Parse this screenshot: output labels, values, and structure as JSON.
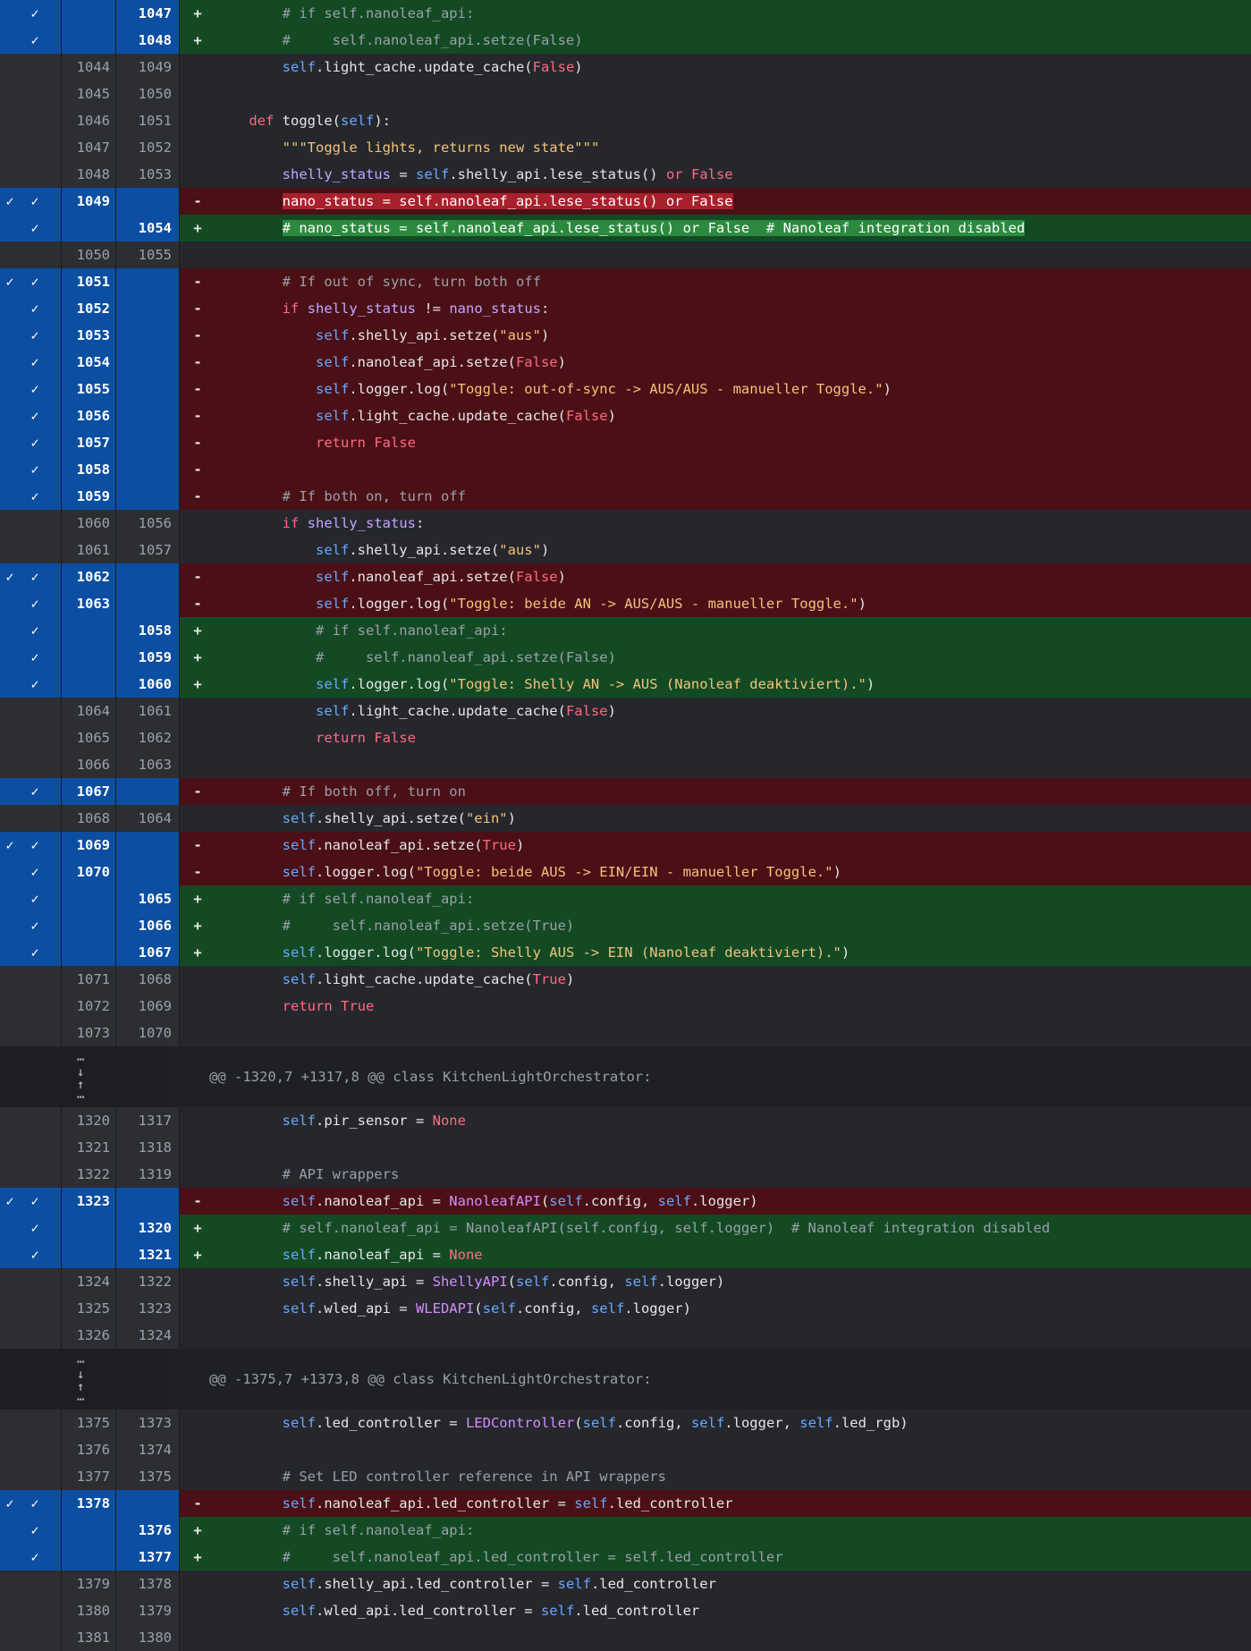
{
  "diff": {
    "rows": [
      {
        "type": "hunk_tail_add",
        "old": "",
        "new": "1047",
        "mark": "+",
        "code": "        # if self.nanoleaf_api:",
        "style": "add",
        "sel": true,
        "checks": 1
      },
      {
        "type": "add",
        "old": "",
        "new": "1048",
        "mark": "+",
        "code": "        #     self.nanoleaf_api.setze(False)",
        "style": "add",
        "sel": true,
        "checks": 1
      },
      {
        "type": "ctx",
        "old": "1044",
        "new": "1049",
        "mark": "",
        "code": "        self.light_cache.update_cache(False)",
        "style": "ctx",
        "sel": false
      },
      {
        "type": "ctx",
        "old": "1045",
        "new": "1050",
        "mark": "",
        "code": "",
        "style": "ctx",
        "sel": false
      },
      {
        "type": "ctx",
        "old": "1046",
        "new": "1051",
        "mark": "",
        "code": "    def toggle(self):",
        "style": "ctx",
        "sel": false
      },
      {
        "type": "ctx",
        "old": "1047",
        "new": "1052",
        "mark": "",
        "code": "        \"\"\"Toggle lights, returns new state\"\"\"",
        "style": "ctx",
        "sel": false
      },
      {
        "type": "ctx",
        "old": "1048",
        "new": "1053",
        "mark": "",
        "code": "        shelly_status = self.shelly_api.lese_status() or False",
        "style": "ctx",
        "sel": false
      },
      {
        "type": "del",
        "old": "1049",
        "new": "",
        "mark": "-",
        "code": "        nano_status = self.nanoleaf_api.lese_status() or False",
        "style": "del",
        "sel": true,
        "checks": 2,
        "hl": true
      },
      {
        "type": "add",
        "old": "",
        "new": "1054",
        "mark": "+",
        "code": "        # nano_status = self.nanoleaf_api.lese_status() or False  # Nanoleaf integration disabled",
        "style": "add",
        "sel": true,
        "checks": 1,
        "hl": true
      },
      {
        "type": "ctx",
        "old": "1050",
        "new": "1055",
        "mark": "",
        "code": "",
        "style": "ctx",
        "sel": false
      },
      {
        "type": "del",
        "old": "1051",
        "new": "",
        "mark": "-",
        "code": "        # If out of sync, turn both off",
        "style": "del",
        "sel": true,
        "checks": 2
      },
      {
        "type": "del",
        "old": "1052",
        "new": "",
        "mark": "-",
        "code": "        if shelly_status != nano_status:",
        "style": "del",
        "sel": true,
        "checks": 1
      },
      {
        "type": "del",
        "old": "1053",
        "new": "",
        "mark": "-",
        "code": "            self.shelly_api.setze(\"aus\")",
        "style": "del",
        "sel": true,
        "checks": 1
      },
      {
        "type": "del",
        "old": "1054",
        "new": "",
        "mark": "-",
        "code": "            self.nanoleaf_api.setze(False)",
        "style": "del",
        "sel": true,
        "checks": 1
      },
      {
        "type": "del",
        "old": "1055",
        "new": "",
        "mark": "-",
        "code": "            self.logger.log(\"Toggle: out-of-sync -> AUS/AUS - manueller Toggle.\")",
        "style": "del",
        "sel": true,
        "checks": 1
      },
      {
        "type": "del",
        "old": "1056",
        "new": "",
        "mark": "-",
        "code": "            self.light_cache.update_cache(False)",
        "style": "del",
        "sel": true,
        "checks": 1
      },
      {
        "type": "del",
        "old": "1057",
        "new": "",
        "mark": "-",
        "code": "            return False",
        "style": "del",
        "sel": true,
        "checks": 1
      },
      {
        "type": "del",
        "old": "1058",
        "new": "",
        "mark": "-",
        "code": "",
        "style": "del",
        "sel": true,
        "checks": 1
      },
      {
        "type": "del",
        "old": "1059",
        "new": "",
        "mark": "-",
        "code": "        # If both on, turn off",
        "style": "del",
        "sel": true,
        "checks": 1
      },
      {
        "type": "ctx",
        "old": "1060",
        "new": "1056",
        "mark": "",
        "code": "        if shelly_status:",
        "style": "ctx",
        "sel": false
      },
      {
        "type": "ctx",
        "old": "1061",
        "new": "1057",
        "mark": "",
        "code": "            self.shelly_api.setze(\"aus\")",
        "style": "ctx",
        "sel": false
      },
      {
        "type": "del",
        "old": "1062",
        "new": "",
        "mark": "-",
        "code": "            self.nanoleaf_api.setze(False)",
        "style": "del",
        "sel": true,
        "checks": 2
      },
      {
        "type": "del",
        "old": "1063",
        "new": "",
        "mark": "-",
        "code": "            self.logger.log(\"Toggle: beide AN -> AUS/AUS - manueller Toggle.\")",
        "style": "del",
        "sel": true,
        "checks": 1
      },
      {
        "type": "add",
        "old": "",
        "new": "1058",
        "mark": "+",
        "code": "            # if self.nanoleaf_api:",
        "style": "add",
        "sel": true,
        "checks": 1
      },
      {
        "type": "add",
        "old": "",
        "new": "1059",
        "mark": "+",
        "code": "            #     self.nanoleaf_api.setze(False)",
        "style": "add",
        "sel": true,
        "checks": 1
      },
      {
        "type": "add",
        "old": "",
        "new": "1060",
        "mark": "+",
        "code": "            self.logger.log(\"Toggle: Shelly AN -> AUS (Nanoleaf deaktiviert).\")",
        "style": "add",
        "sel": true,
        "checks": 1
      },
      {
        "type": "ctx",
        "old": "1064",
        "new": "1061",
        "mark": "",
        "code": "            self.light_cache.update_cache(False)",
        "style": "ctx",
        "sel": false
      },
      {
        "type": "ctx",
        "old": "1065",
        "new": "1062",
        "mark": "",
        "code": "            return False",
        "style": "ctx",
        "sel": false
      },
      {
        "type": "ctx",
        "old": "1066",
        "new": "1063",
        "mark": "",
        "code": "",
        "style": "ctx",
        "sel": false
      },
      {
        "type": "del",
        "old": "1067",
        "new": "",
        "mark": "-",
        "code": "        # If both off, turn on",
        "style": "del",
        "sel": true,
        "checks": 1
      },
      {
        "type": "ctx",
        "old": "1068",
        "new": "1064",
        "mark": "",
        "code": "        self.shelly_api.setze(\"ein\")",
        "style": "ctx",
        "sel": false
      },
      {
        "type": "del",
        "old": "1069",
        "new": "",
        "mark": "-",
        "code": "        self.nanoleaf_api.setze(True)",
        "style": "del",
        "sel": true,
        "checks": 2
      },
      {
        "type": "del",
        "old": "1070",
        "new": "",
        "mark": "-",
        "code": "        self.logger.log(\"Toggle: beide AUS -> EIN/EIN - manueller Toggle.\")",
        "style": "del",
        "sel": true,
        "checks": 1
      },
      {
        "type": "add",
        "old": "",
        "new": "1065",
        "mark": "+",
        "code": "        # if self.nanoleaf_api:",
        "style": "add",
        "sel": true,
        "checks": 1
      },
      {
        "type": "add",
        "old": "",
        "new": "1066",
        "mark": "+",
        "code": "        #     self.nanoleaf_api.setze(True)",
        "style": "add",
        "sel": true,
        "checks": 1
      },
      {
        "type": "add",
        "old": "",
        "new": "1067",
        "mark": "+",
        "code": "        self.logger.log(\"Toggle: Shelly AUS -> EIN (Nanoleaf deaktiviert).\")",
        "style": "add",
        "sel": true,
        "checks": 1
      },
      {
        "type": "ctx",
        "old": "1071",
        "new": "1068",
        "mark": "",
        "code": "        self.light_cache.update_cache(True)",
        "style": "ctx",
        "sel": false
      },
      {
        "type": "ctx",
        "old": "1072",
        "new": "1069",
        "mark": "",
        "code": "        return True",
        "style": "ctx",
        "sel": false
      },
      {
        "type": "ctx",
        "old": "1073",
        "new": "1070",
        "mark": "",
        "code": "",
        "style": "ctx",
        "sel": false
      },
      {
        "type": "hunk",
        "header": "@@ -1320,7 +1317,8 @@ class KitchenLightOrchestrator:"
      },
      {
        "type": "ctx",
        "old": "1320",
        "new": "1317",
        "mark": "",
        "code": "        self.pir_sensor = None",
        "style": "ctx",
        "sel": false
      },
      {
        "type": "ctx",
        "old": "1321",
        "new": "1318",
        "mark": "",
        "code": "",
        "style": "ctx",
        "sel": false
      },
      {
        "type": "ctx",
        "old": "1322",
        "new": "1319",
        "mark": "",
        "code": "        # API wrappers",
        "style": "ctx",
        "sel": false
      },
      {
        "type": "del",
        "old": "1323",
        "new": "",
        "mark": "-",
        "code": "        self.nanoleaf_api = NanoleafAPI(self.config, self.logger)",
        "style": "del",
        "sel": true,
        "checks": 2
      },
      {
        "type": "add",
        "old": "",
        "new": "1320",
        "mark": "+",
        "code": "        # self.nanoleaf_api = NanoleafAPI(self.config, self.logger)  # Nanoleaf integration disabled",
        "style": "add",
        "sel": true,
        "checks": 1
      },
      {
        "type": "add",
        "old": "",
        "new": "1321",
        "mark": "+",
        "code": "        self.nanoleaf_api = None",
        "style": "add",
        "sel": true,
        "checks": 1
      },
      {
        "type": "ctx",
        "old": "1324",
        "new": "1322",
        "mark": "",
        "code": "        self.shelly_api = ShellyAPI(self.config, self.logger)",
        "style": "ctx",
        "sel": false
      },
      {
        "type": "ctx",
        "old": "1325",
        "new": "1323",
        "mark": "",
        "code": "        self.wled_api = WLEDAPI(self.config, self.logger)",
        "style": "ctx",
        "sel": false
      },
      {
        "type": "ctx",
        "old": "1326",
        "new": "1324",
        "mark": "",
        "code": "",
        "style": "ctx",
        "sel": false
      },
      {
        "type": "hunk",
        "header": "@@ -1375,7 +1373,8 @@ class KitchenLightOrchestrator:"
      },
      {
        "type": "ctx",
        "old": "1375",
        "new": "1373",
        "mark": "",
        "code": "        self.led_controller = LEDController(self.config, self.logger, self.led_rgb)",
        "style": "ctx",
        "sel": false
      },
      {
        "type": "ctx",
        "old": "1376",
        "new": "1374",
        "mark": "",
        "code": "",
        "style": "ctx",
        "sel": false
      },
      {
        "type": "ctx",
        "old": "1377",
        "new": "1375",
        "mark": "",
        "code": "        # Set LED controller reference in API wrappers",
        "style": "ctx",
        "sel": false
      },
      {
        "type": "del",
        "old": "1378",
        "new": "",
        "mark": "-",
        "code": "        self.nanoleaf_api.led_controller = self.led_controller",
        "style": "del",
        "sel": true,
        "checks": 2
      },
      {
        "type": "add",
        "old": "",
        "new": "1376",
        "mark": "+",
        "code": "        # if self.nanoleaf_api:",
        "style": "add",
        "sel": true,
        "checks": 1
      },
      {
        "type": "add",
        "old": "",
        "new": "1377",
        "mark": "+",
        "code": "        #     self.nanoleaf_api.led_controller = self.led_controller",
        "style": "add",
        "sel": true,
        "checks": 1
      },
      {
        "type": "ctx",
        "old": "1379",
        "new": "1378",
        "mark": "",
        "code": "        self.shelly_api.led_controller = self.led_controller",
        "style": "ctx",
        "sel": false
      },
      {
        "type": "ctx",
        "old": "1380",
        "new": "1379",
        "mark": "",
        "code": "        self.wled_api.led_controller = self.led_controller",
        "style": "ctx",
        "sel": false
      },
      {
        "type": "ctx",
        "old": "1381",
        "new": "1380",
        "mark": "",
        "code": "",
        "style": "ctx",
        "sel": false
      }
    ]
  },
  "icons": {
    "check": "check-icon",
    "expand_down": "expand-down-icon",
    "expand_up": "expand-up-icon"
  },
  "colors": {
    "selected": "#0b4ea2",
    "deleted": "#4a1016",
    "added": "#134a24",
    "deleted_hl": "#a8202c",
    "added_hl": "#2b8a3e"
  }
}
